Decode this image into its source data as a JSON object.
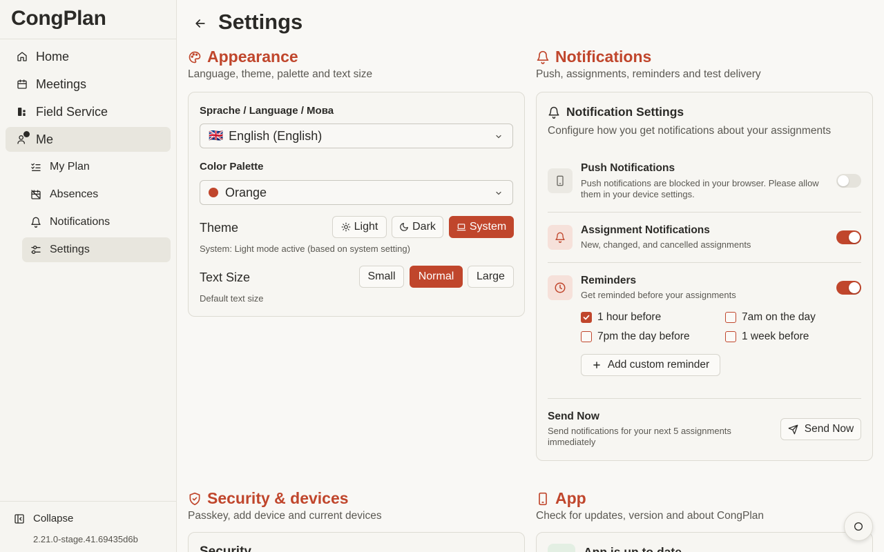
{
  "sidebar": {
    "brand": "CongPlan",
    "nav": [
      {
        "label": "Home",
        "icon": "home-icon"
      },
      {
        "label": "Meetings",
        "icon": "calendar-icon"
      },
      {
        "label": "Field Service",
        "icon": "field-service-icon"
      },
      {
        "label": "Me",
        "icon": "user-icon"
      }
    ],
    "sub": [
      {
        "label": "My Plan",
        "icon": "list-checks-icon"
      },
      {
        "label": "Absences",
        "icon": "calendar-off-icon"
      },
      {
        "label": "Notifications",
        "icon": "bell-icon"
      },
      {
        "label": "Settings",
        "icon": "sliders-icon"
      }
    ],
    "collapse_label": "Collapse",
    "version": "2.21.0-stage.41.69435d6b"
  },
  "header": {
    "title": "Settings"
  },
  "appearance": {
    "title": "Appearance",
    "subtitle": "Language, theme, palette and text size",
    "language_label": "Sprache / Language / Мова",
    "language_flag": "🇬🇧",
    "language_value": "English (English)",
    "palette_label": "Color Palette",
    "palette_value": "Orange",
    "palette_color": "#c0462c",
    "theme_label": "Theme",
    "theme_options": [
      "Light",
      "Dark",
      "System"
    ],
    "theme_selected": "System",
    "theme_hint": "System: Light mode active (based on system setting)",
    "text_size_label": "Text Size",
    "text_size_options": [
      "Small",
      "Normal",
      "Large"
    ],
    "text_size_selected": "Normal",
    "text_size_hint": "Default text size"
  },
  "notifications": {
    "title": "Notifications",
    "subtitle": "Push, assignments, reminders and test delivery",
    "card_title": "Notification Settings",
    "card_desc": "Configure how you get notifications about your assignments",
    "push": {
      "title": "Push Notifications",
      "desc_line1": "Push notifications are blocked in your browser. Please allow",
      "desc_line2": "them in your device settings.",
      "enabled": false
    },
    "assignment": {
      "title": "Assignment Notifications",
      "desc": "New, changed, and cancelled assignments",
      "enabled": true
    },
    "reminders": {
      "title": "Reminders",
      "desc": "Get reminded before your assignments",
      "enabled": true,
      "options": [
        {
          "label": "1 hour before",
          "checked": true
        },
        {
          "label": "7am on the day",
          "checked": false
        },
        {
          "label": "7pm the day before",
          "checked": false
        },
        {
          "label": "1 week before",
          "checked": false
        }
      ],
      "add_label": "Add custom reminder"
    },
    "send_now": {
      "title": "Send Now",
      "desc_line1": "Send notifications for your next 5 assignments",
      "desc_line2": "immediately",
      "button_label": "Send Now"
    }
  },
  "security": {
    "title": "Security & devices",
    "subtitle": "Passkey, add device and current devices",
    "card_title_peek": "Security"
  },
  "app": {
    "title": "App",
    "subtitle": "Check for updates, version and about CongPlan",
    "card_title_peek": "App is up to date"
  },
  "colors": {
    "accent": "#c0462c",
    "sidebar_bg": "#f6f5f1",
    "page_bg": "#f9f8f5"
  }
}
